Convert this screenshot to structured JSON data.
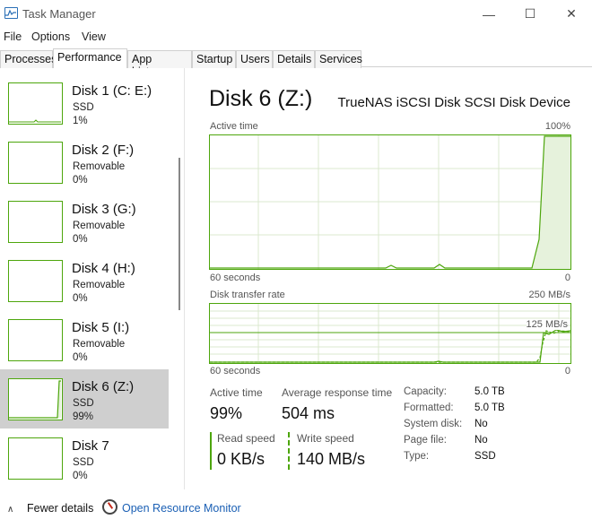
{
  "window": {
    "title": "Task Manager",
    "min": "—",
    "max": "☐",
    "close": "✕"
  },
  "menu": [
    "File",
    "Options",
    "View"
  ],
  "tabs": [
    "Processes",
    "Performance",
    "App history",
    "Startup",
    "Users",
    "Details",
    "Services"
  ],
  "active_tab": "Performance",
  "sidebar": {
    "items": [
      {
        "name": "Disk 1 (C: E:)",
        "type": "SSD",
        "usage": "1%"
      },
      {
        "name": "Disk 2 (F:)",
        "type": "Removable",
        "usage": "0%"
      },
      {
        "name": "Disk 3 (G:)",
        "type": "Removable",
        "usage": "0%"
      },
      {
        "name": "Disk 4 (H:)",
        "type": "Removable",
        "usage": "0%"
      },
      {
        "name": "Disk 5 (I:)",
        "type": "Removable",
        "usage": "0%"
      },
      {
        "name": "Disk 6 (Z:)",
        "type": "SSD",
        "usage": "99%"
      },
      {
        "name": "Disk 7",
        "type": "SSD",
        "usage": "0%"
      }
    ],
    "selected_index": 5
  },
  "main": {
    "title": "Disk 6 (Z:)",
    "device": "TrueNAS iSCSI Disk SCSI Disk Device",
    "active_chart": {
      "label": "Active time",
      "max_label": "100%",
      "time_label": "60 seconds",
      "zero_label": "0"
    },
    "transfer_chart": {
      "label": "Disk transfer rate",
      "max_label": "250 MB/s",
      "mid_label": "125 MB/s",
      "time_label": "60 seconds",
      "zero_label": "0"
    },
    "stats": {
      "active_time_label": "Active time",
      "active_time_value": "99%",
      "avg_response_label": "Average response time",
      "avg_response_value": "504 ms",
      "read_label": "Read speed",
      "read_value": "0 KB/s",
      "write_label": "Write speed",
      "write_value": "140 MB/s"
    },
    "details": [
      {
        "key": "Capacity:",
        "value": "5.0 TB"
      },
      {
        "key": "Formatted:",
        "value": "5.0 TB"
      },
      {
        "key": "System disk:",
        "value": "No"
      },
      {
        "key": "Page file:",
        "value": "No"
      },
      {
        "key": "Type:",
        "value": "SSD"
      }
    ]
  },
  "footer": {
    "fewer_details": "Fewer details",
    "resource_monitor": "Open Resource Monitor"
  },
  "colors": {
    "accent": "#4da60c",
    "link": "#1a5fb4",
    "selected": "#cfcfcf"
  },
  "icons": [
    "task-manager-icon",
    "chevron-up-icon",
    "resource-monitor-icon"
  ]
}
